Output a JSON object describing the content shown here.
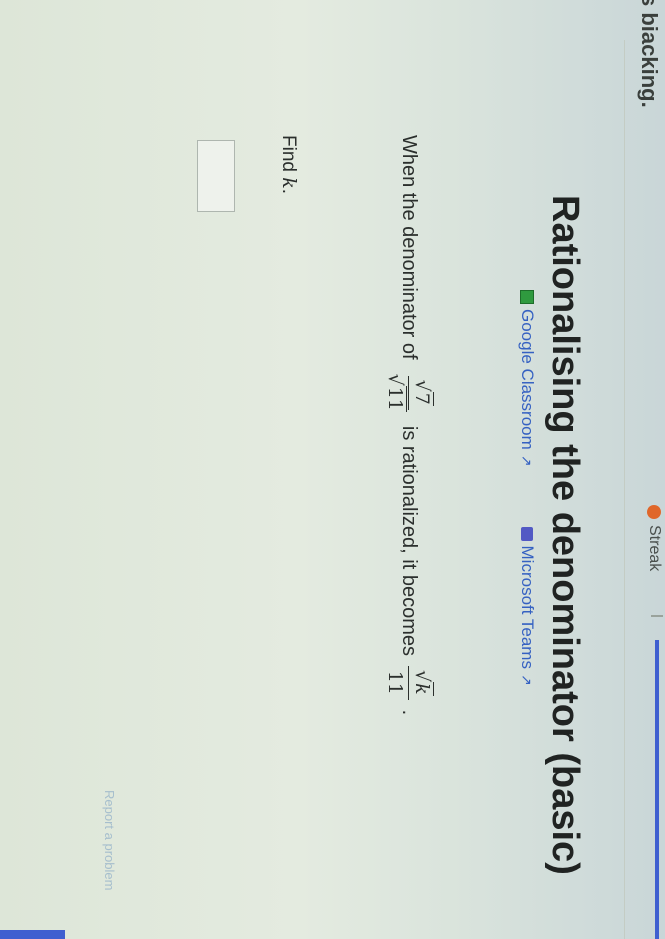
{
  "header": {
    "top_label": "s biacking.",
    "streak_label": "Streak",
    "accent_color": "#3f5fd0",
    "streak_color": "#e0672a"
  },
  "title": "Rationalising the denominator (basic)",
  "share": {
    "google_classroom": "Google Classroom",
    "microsoft_teams": "Microsoft Teams",
    "external_link_icon": "external-link-icon"
  },
  "question": {
    "lead": "When the denominator of",
    "fraction_num": "7",
    "fraction_den": "11",
    "middle": "is rationalized, it becomes",
    "result_num": "k",
    "result_den": "11",
    "end": "."
  },
  "prompt": {
    "find_prefix": "Find",
    "variable": "k",
    "suffix": "."
  },
  "footer": {
    "report_link": "Report a problem"
  }
}
